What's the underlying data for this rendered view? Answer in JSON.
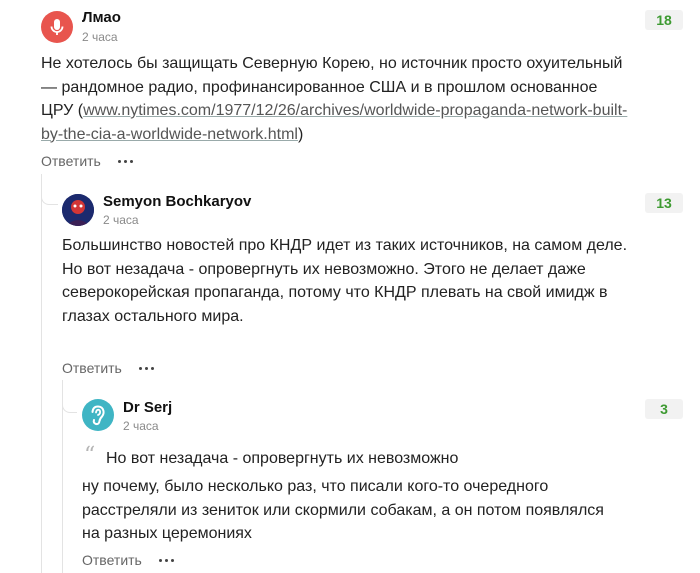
{
  "comments": [
    {
      "author": "Лмао",
      "time": "2 часа",
      "rating": "18",
      "avatar_icon": "microphone-icon",
      "avatar_color": "#e8554e",
      "text_before": "Не хотелось бы защищать Северную Корею, но источник просто охуительный — рандомное радио, профинансированное США и в прошлом основанное ЦРУ (",
      "link": "www.nytimes.com/1977/12/26/archives/worldwide-propaganda-network-built-by-the-cia-a-worldwide-network.html",
      "text_after": ")",
      "reply_label": "Ответить"
    },
    {
      "author": "Semyon Bochkaryov",
      "time": "2 часа",
      "rating": "13",
      "paragraphs": [
        "Большинство новостей про КНДР идет из таких источников, на самом деле.",
        "Но вот незадача - опровергнуть их невозможно. Этого не делает даже северокорейская пропаганда, потому что КНДР плевать на свой имидж в глазах остального мира."
      ],
      "reply_label": "Ответить"
    },
    {
      "author": "Dr Serj",
      "time": "2 часа",
      "rating": "3",
      "avatar_icon": "ear-icon",
      "avatar_color": "#3fb5c4",
      "quote": "Но вот незадача - опровергнуть их невозможно",
      "text": "ну почему, было несколько раз, что писали кого-то очередного расстреляли из зениток или скормили собакам, а он потом появлялся на разных церемониях",
      "reply_label": "Ответить"
    }
  ],
  "colors": {
    "rating_text": "#3d9a31",
    "rating_bg": "#f2f2f2",
    "avatar_red": "#e8554e",
    "avatar_teal": "#3fb5c4"
  }
}
